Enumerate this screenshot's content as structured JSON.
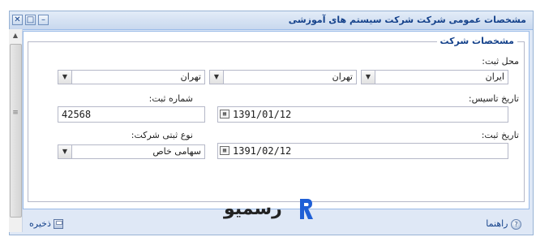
{
  "window": {
    "title": "مشخصات عمومی شرکت شرکت سیستم های آموزشی",
    "controls": {
      "close": "✕",
      "maximize": "□",
      "minimize": "–"
    }
  },
  "form": {
    "legend": "مشخصات شرکت",
    "location_label": "محل ثبت:",
    "country_value": "ایران",
    "province_value": "تهران",
    "city_value": "تهران",
    "founding_date_label": "تاریخ تاسیس:",
    "founding_date_value": "1391/01/12",
    "registration_number_label": "شماره ثبت:",
    "registration_number_value": "42568",
    "registration_date_label": "تاریخ ثبت:",
    "registration_date_value": "1391/02/12",
    "company_type_label": "نوع ثبتی شرکت:",
    "company_type_value": "سهامی خاص"
  },
  "footer": {
    "help_label": "راهنما",
    "save_label": "ذخیره",
    "logo_text": "رسمیو"
  },
  "colors": {
    "accent": "#15428b",
    "logo": "#1f5fd6"
  }
}
